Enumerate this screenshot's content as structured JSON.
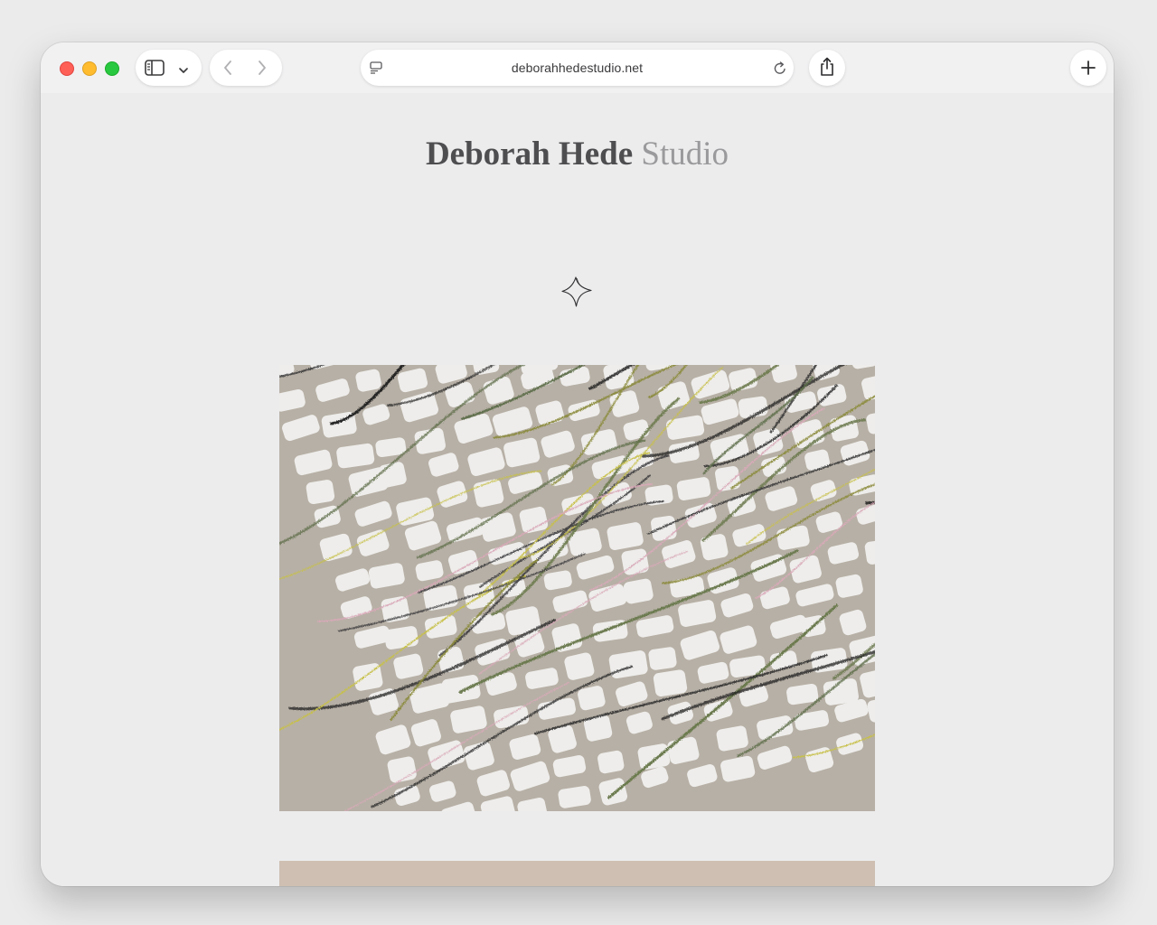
{
  "browser": {
    "url": "deborahhedestudio.net",
    "icons": {
      "sidebar": "sidebar-icon",
      "chevron": "chevron-down-icon",
      "back": "back-icon",
      "forward": "forward-icon",
      "page_menu": "page-menu-icon",
      "reload": "reload-icon",
      "share": "share-icon",
      "new_tab": "plus-icon"
    }
  },
  "site": {
    "title_primary": "Deborah Hede",
    "title_secondary": "Studio",
    "logo_icon": "star-logo-icon"
  },
  "colors": {
    "close": "#fe5f57",
    "minimize": "#febc2e",
    "maximize": "#28c840",
    "page_bg": "#ececed",
    "title_primary": "#4e4e50",
    "title_secondary": "#9a9a9c"
  }
}
